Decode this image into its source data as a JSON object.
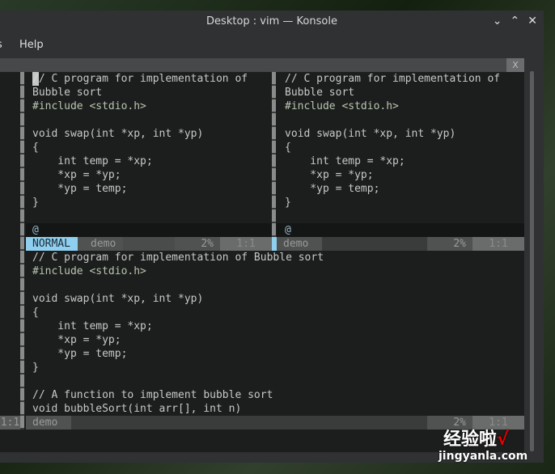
{
  "window": {
    "title": "Desktop : vim — Konsole",
    "buttons": [
      "minimize",
      "maximize",
      "close"
    ]
  },
  "menu": {
    "items": [
      "s",
      "Help"
    ]
  },
  "tab": {
    "close_label": "X"
  },
  "panes": {
    "top_left": {
      "lines": [
        "// C program for implementation of",
        "Bubble sort",
        "#include <stdio.h>",
        "",
        "void swap(int *xp, int *yp)",
        "{",
        "    int temp = *xp;",
        "    *xp = *yp;",
        "    *yp = temp;",
        "}",
        "",
        ""
      ],
      "cmd": "@",
      "status": {
        "mode": "NORMAL",
        "file": "demo",
        "percent": "2%",
        "position": "1:1"
      }
    },
    "top_right": {
      "lines": [
        "// C program for implementation of",
        "Bubble sort",
        "#include <stdio.h>",
        "",
        "void swap(int *xp, int *yp)",
        "{",
        "    int temp = *xp;",
        "    *xp = *yp;",
        "    *yp = temp;",
        "}",
        "",
        ""
      ],
      "cmd": "@",
      "status": {
        "file": "demo",
        "percent": "2%",
        "position": "1:1"
      }
    },
    "bottom": {
      "lines": [
        "// C program for implementation of Bubble sort",
        "#include <stdio.h>",
        "",
        "void swap(int *xp, int *yp)",
        "{",
        "    int temp = *xp;",
        "    *xp = *yp;",
        "    *yp = temp;",
        "}",
        "",
        "// A function to implement bubble sort",
        "void bubbleSort(int arr[], int n)"
      ],
      "status": {
        "file": "demo",
        "percent": "2%",
        "position": "1:1"
      }
    },
    "left_edge": {
      "status_position": "1:1"
    }
  },
  "colors": {
    "mode_bg": "#8fd0f0",
    "background": "#1c1e1e"
  },
  "watermark": {
    "text": "经验啦",
    "url_text": "jingyanla.com"
  }
}
